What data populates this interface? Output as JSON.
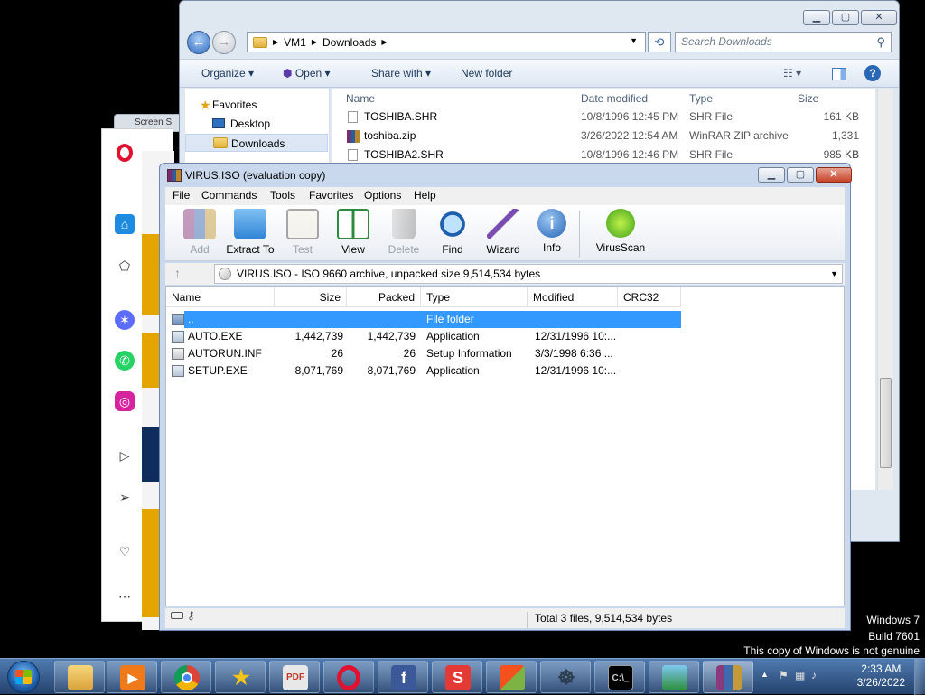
{
  "explorer": {
    "breadcrumb": [
      "VM1",
      "Downloads"
    ],
    "search_placeholder": "Search Downloads",
    "toolbar": {
      "organize": "Organize",
      "open": "Open",
      "share_with": "Share with",
      "new_folder": "New folder"
    },
    "nav": {
      "favorites": "Favorites",
      "desktop": "Desktop",
      "downloads": "Downloads"
    },
    "columns": {
      "name": "Name",
      "date": "Date modified",
      "type": "Type",
      "size": "Size"
    },
    "files": [
      {
        "name": "TOSHIBA.SHR",
        "date": "10/8/1996 12:45 PM",
        "type": "SHR File",
        "size": "161 KB"
      },
      {
        "name": "toshiba.zip",
        "date": "3/26/2022 12:54 AM",
        "type": "WinRAR ZIP archive",
        "size": "1,331 KB"
      },
      {
        "name": "TOSHIBA2.SHR",
        "date": "10/8/1996 12:46 PM",
        "type": "SHR File",
        "size": "985 KB"
      }
    ]
  },
  "winrar": {
    "title": "VIRUS.ISO (evaluation copy)",
    "menu": [
      "File",
      "Commands",
      "Tools",
      "Favorites",
      "Options",
      "Help"
    ],
    "tools": [
      {
        "label": "Add",
        "icon": "add-archive-icon",
        "enabled": false
      },
      {
        "label": "Extract To",
        "icon": "extract-folder-icon",
        "enabled": true
      },
      {
        "label": "Test",
        "icon": "test-clipboard-icon",
        "enabled": false
      },
      {
        "label": "View",
        "icon": "view-book-icon",
        "enabled": true
      },
      {
        "label": "Delete",
        "icon": "trash-icon",
        "enabled": false
      },
      {
        "label": "Find",
        "icon": "magnifier-icon",
        "enabled": true
      },
      {
        "label": "Wizard",
        "icon": "wand-icon",
        "enabled": true
      },
      {
        "label": "Info",
        "icon": "info-icon",
        "enabled": true
      },
      {
        "label": "VirusScan",
        "icon": "virus-scan-icon",
        "enabled": true
      }
    ],
    "path": "VIRUS.ISO - ISO 9660 archive, unpacked size 9,514,534 bytes",
    "columns": {
      "name": "Name",
      "size": "Size",
      "packed": "Packed",
      "type": "Type",
      "modified": "Modified",
      "crc": "CRC32"
    },
    "rows": [
      {
        "name": "..",
        "size": "",
        "packed": "",
        "type": "File folder",
        "modified": "",
        "crc": ""
      },
      {
        "name": "AUTO.EXE",
        "size": "1,442,739",
        "packed": "1,442,739",
        "type": "Application",
        "modified": "12/31/1996 10:...",
        "crc": ""
      },
      {
        "name": "AUTORUN.INF",
        "size": "26",
        "packed": "26",
        "type": "Setup Information",
        "modified": "3/3/1998 6:36 ...",
        "crc": ""
      },
      {
        "name": "SETUP.EXE",
        "size": "8,071,769",
        "packed": "8,071,769",
        "type": "Application",
        "modified": "12/31/1996 10:...",
        "crc": ""
      }
    ],
    "status": "Total 3 files, 9,514,534 bytes"
  },
  "watermark": {
    "line1": "Windows 7",
    "line2": "Build 7601",
    "line3": "This copy of Windows is not genuine"
  },
  "taskbar": {
    "apps": [
      "explorer",
      "media-player",
      "chrome",
      "favorites-star",
      "pdf",
      "opera",
      "facebook",
      "app-s",
      "app-chat",
      "ccleaner",
      "cmd",
      "network",
      "winrar"
    ],
    "time": "2:33 AM",
    "date": "3/26/2022"
  },
  "colors": {
    "selection": "#3399ff",
    "taskbar": "#2d5286",
    "winrar_frame": "#c9d8ec"
  }
}
